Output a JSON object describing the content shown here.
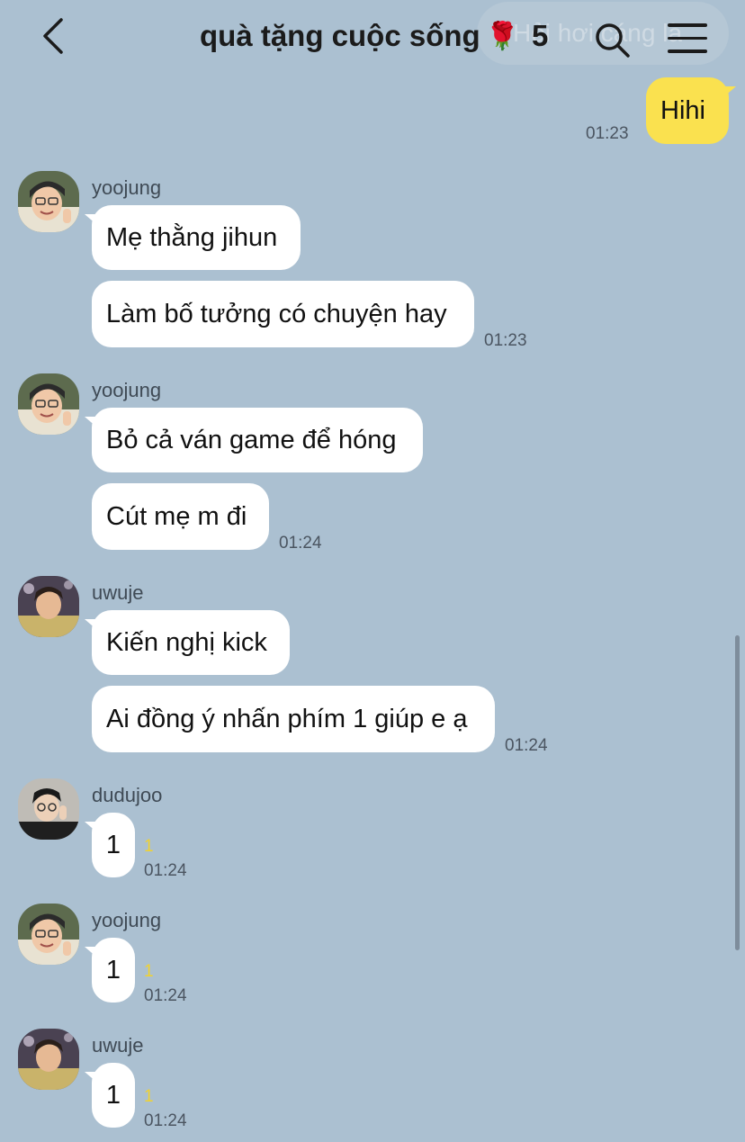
{
  "header": {
    "title": "quà tặng cuộc sống",
    "title_emoji": "🌹",
    "member_count": "5",
    "ghost_search_text": "Hỏi hơi cáng là"
  },
  "messages": {
    "m0": {
      "text": "Hihi",
      "time": "01:23"
    },
    "g1": {
      "sender": "yoojung",
      "b1": "Mẹ thằng jihun",
      "b2": "Làm bố tưởng có chuyện hay",
      "time": "01:23"
    },
    "g2": {
      "sender": "yoojung",
      "b1": "Bỏ cả ván game để hóng",
      "b2": "Cút mẹ m đi",
      "time": "01:24"
    },
    "g3": {
      "sender": "uwuje",
      "b1": "Kiến nghị kick",
      "b2": "Ai đồng ý nhấn phím 1 giúp e ạ",
      "time": "01:24"
    },
    "g4": {
      "sender": "dudujoo",
      "b1": "1",
      "unread": "1",
      "time": "01:24"
    },
    "g5": {
      "sender": "yoojung",
      "b1": "1",
      "unread": "1",
      "time": "01:24"
    },
    "g6": {
      "sender": "uwuje",
      "b1": "1",
      "unread": "1",
      "time": "01:24"
    }
  },
  "colors": {
    "background": "#abc0d1",
    "my_bubble": "#fae14f",
    "other_bubble": "#ffffff",
    "unread": "#f1d22d"
  },
  "icons": {
    "back": "chevron-left-icon",
    "search": "search-icon",
    "menu": "hamburger-menu-icon"
  }
}
